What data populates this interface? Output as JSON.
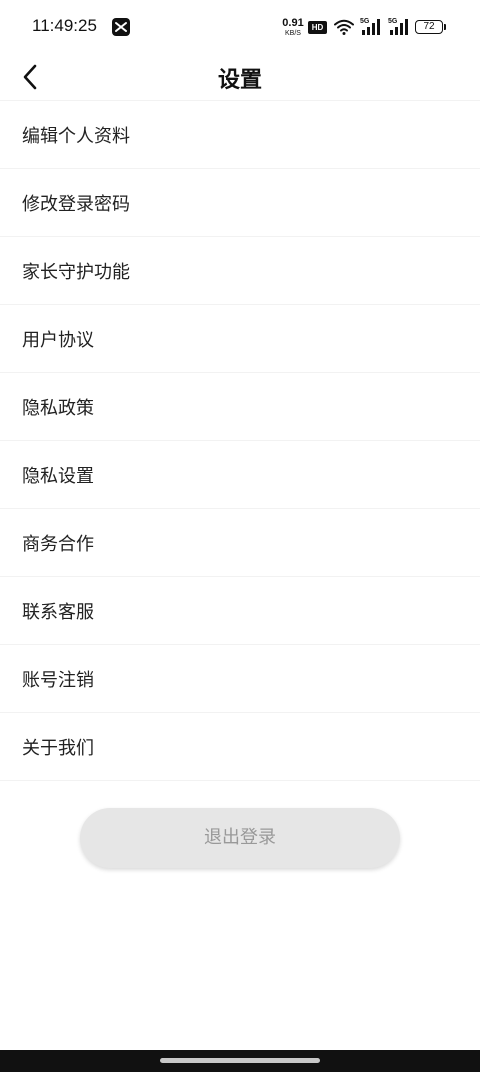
{
  "status_bar": {
    "time": "11:49:25",
    "net_speed_value": "0.91",
    "net_speed_unit": "KB/S",
    "hd_label": "HD",
    "signal_1_label": "5G",
    "signal_2_label": "5G",
    "battery_level": "72",
    "icons": [
      "capcut-icon",
      "hd-icon",
      "wifi-icon",
      "signal-icon",
      "battery-icon"
    ]
  },
  "header": {
    "title": "设置",
    "back_icon": "chevron-left-icon"
  },
  "menu": {
    "items": [
      {
        "label": "编辑个人资料"
      },
      {
        "label": "修改登录密码"
      },
      {
        "label": "家长守护功能"
      },
      {
        "label": "用户协议"
      },
      {
        "label": "隐私政策"
      },
      {
        "label": "隐私设置"
      },
      {
        "label": "商务合作"
      },
      {
        "label": "联系客服"
      },
      {
        "label": "账号注销"
      },
      {
        "label": "关于我们"
      }
    ]
  },
  "logout": {
    "label": "退出登录"
  },
  "colors": {
    "background": "#ffffff",
    "text": "#222222",
    "divider": "#f2f2f2",
    "logout_bg": "#e6e6e6",
    "logout_text": "#999999"
  }
}
